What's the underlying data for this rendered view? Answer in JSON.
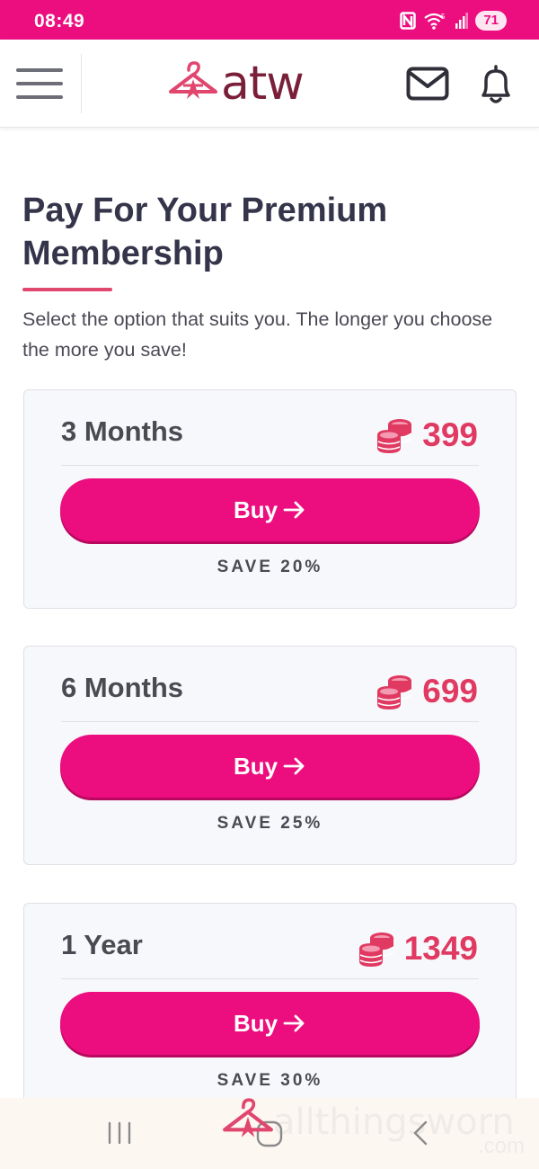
{
  "status_bar": {
    "time": "08:49",
    "battery": "71"
  },
  "header": {
    "logo_text": "atw",
    "brand_color": "#ec0d7f"
  },
  "page": {
    "title": "Pay For Your Premium Membership",
    "subtitle": "Select the option that suits you. The longer you choose the more you save!"
  },
  "plans": [
    {
      "name": "3 Months",
      "price": "399",
      "button_label": "Buy",
      "save": "SAVE 20%"
    },
    {
      "name": "6 Months",
      "price": "699",
      "button_label": "Buy",
      "save": "SAVE 25%"
    },
    {
      "name": "1 Year",
      "price": "1349",
      "button_label": "Buy",
      "save": "SAVE 30%"
    }
  ],
  "watermark": {
    "text": "allthingsworn",
    "sub": ".com"
  },
  "icons": [
    "menu-icon",
    "logo-hanger-icon",
    "mail-icon",
    "bell-icon",
    "coins-icon",
    "arrow-right-icon",
    "nfc-icon",
    "wifi-icon",
    "signal-icon",
    "recents-icon",
    "home-icon",
    "back-icon"
  ],
  "colors": {
    "accent": "#ec0d7f",
    "price": "#e03a62",
    "title": "#34344a"
  }
}
